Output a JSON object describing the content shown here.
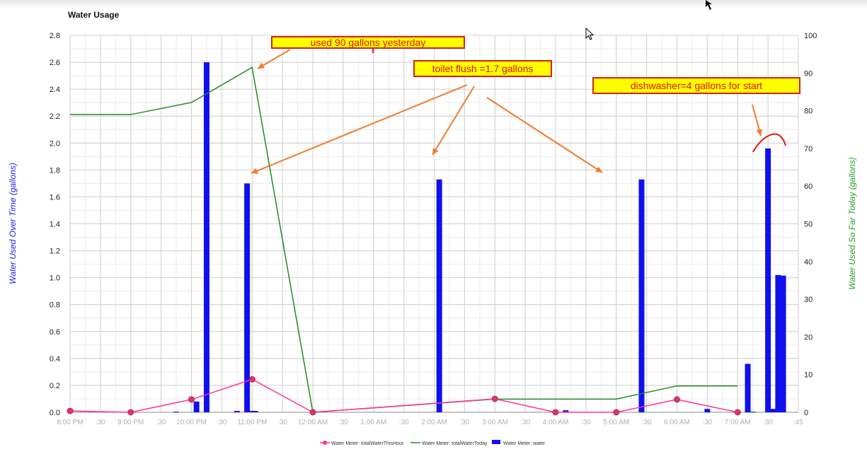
{
  "chart_data": {
    "type": "bar+line",
    "title": "Water Usage",
    "ylabel_left": "Water Used Over Time (gallons)",
    "ylabel_right": "Water Used So Far Today (gallons)",
    "ylim_left": [
      0,
      2.8
    ],
    "ylim_right": [
      0,
      100
    ],
    "y_ticks_left": [
      "0.0",
      "0.2",
      "0.4",
      "0.6",
      "0.8",
      "1.0",
      "1.2",
      "1.4",
      "1.6",
      "1.8",
      "2.0",
      "2.2",
      "2.4",
      "2.6",
      "2.8"
    ],
    "y_ticks_right": [
      "0",
      "10",
      "20",
      "30",
      "40",
      "50",
      "60",
      "70",
      "80",
      "90",
      "100"
    ],
    "x_ticks": [
      "8:00 PM",
      ":30",
      "9:00 PM",
      ":30",
      "10:00 PM",
      ":30",
      "11:00 PM",
      ":30",
      "12:00 AM",
      ":30",
      "1:00 AM",
      ":30",
      "2:00 AM",
      ":30",
      "3:00 AM",
      ":30",
      "4:00 AM",
      ":30",
      "5:00 AM",
      ":30",
      "6:00 AM",
      ":30",
      "7:00 AM",
      ":30",
      ":45"
    ],
    "grid": true,
    "legend_position": "bottom",
    "series": [
      {
        "name": "Water Meter: totalWaterThisHour",
        "type": "line",
        "axis": "left",
        "color": "#ff3399",
        "markers": true,
        "x": [
          "8:00 PM",
          "9:00 PM",
          "10:00 PM",
          "11:00 PM",
          "12:00 AM",
          "3:00 AM",
          "4:00 AM",
          "5:00 AM",
          "6:00 AM",
          "7:00 AM"
        ],
        "values": [
          0.01,
          0.0,
          0.095,
          0.245,
          0.0,
          0.1,
          0.0,
          0.0,
          0.095,
          0.0
        ]
      },
      {
        "name": "Water Meter: totalWaterToday",
        "type": "line",
        "axis": "right",
        "color": "#228b22",
        "markers": false,
        "x": [
          "8:00 PM",
          "9:00 PM",
          "10:00 PM",
          "11:00 PM",
          "12:00 AM",
          "3:00 AM",
          "5:00 AM",
          "6:00 AM",
          "7:00 AM"
        ],
        "values": [
          79,
          79,
          82.2,
          91.5,
          0,
          3.5,
          3.5,
          7,
          7
        ]
      },
      {
        "name": "Water Meter: water",
        "type": "bar",
        "axis": "left",
        "color": "#1010ee",
        "x": [
          "9:45 PM",
          "10:05 PM",
          "10:15 PM",
          "10:45 PM",
          "10:55 PM",
          "11:00 PM",
          "11:03 PM",
          "2:05 AM",
          "4:10 AM",
          "5:25 AM",
          "6:30 AM",
          "7:10 AM",
          "7:15 AM",
          "7:30 AM",
          "7:35 AM",
          "7:40 AM",
          "7:45 AM"
        ],
        "values": [
          0.005,
          0.08,
          2.6,
          0.01,
          1.7,
          0.01,
          0.01,
          1.73,
          0.015,
          1.73,
          0.025,
          0.36,
          0.005,
          1.96,
          0.025,
          1.02,
          1.015
        ]
      }
    ]
  },
  "annotations": [
    {
      "id": "yesterday",
      "text": "used 90 gallons yesterday"
    },
    {
      "id": "toilet",
      "text": "toilet flush =1.7 gallons"
    },
    {
      "id": "dishwasher",
      "text": "dishwasher=4 gallons for start"
    }
  ],
  "colors": {
    "arrow": "#f07c2c",
    "grid": "#dcdcdc",
    "axis_label_left": "#1a1ae6",
    "axis_label_right": "#22a022",
    "tick_label": "#b0b0b0"
  }
}
